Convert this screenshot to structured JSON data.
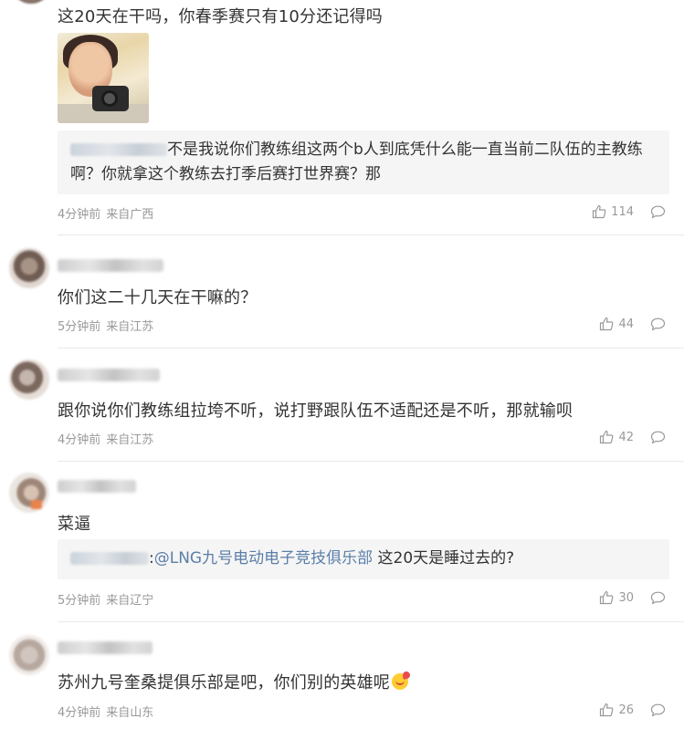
{
  "comments": [
    {
      "text": "这20天在干吗，你春季赛只有10分还记得吗",
      "reply_quote": "不是我说你们教练组这两个b人到底凭什么能一直当前二队伍的主教练",
      "reply_quote_line2": "啊？你就拿这个教练去打季后赛打世界赛？那",
      "time": "4分钟前",
      "location": "来自广西",
      "likes": "114"
    },
    {
      "text": "你们这二十几天在干嘛的？",
      "time": "5分钟前",
      "location": "来自江苏",
      "likes": "44"
    },
    {
      "text": "跟你说你们教练组拉垮不听，说打野跟队伍不适配还是不听，那就输呗",
      "time": "4分钟前",
      "location": "来自江苏",
      "likes": "42"
    },
    {
      "text": "菜逼",
      "reply_prefix": ":",
      "reply_mention": "@LNG九号电动电子竞技俱乐部",
      "reply_text": " 这20天是睡过去的?",
      "time": "5分钟前",
      "location": "来自辽宁",
      "likes": "30"
    },
    {
      "text": "苏州九号奎桑提俱乐部是吧，你们别的英雄呢",
      "time": "4分钟前",
      "location": "来自山东",
      "likes": "26"
    }
  ],
  "icons": {
    "like": "thumbs-up-icon",
    "reply": "comment-bubble-icon",
    "emoji": "heart-kiss-emoji-icon"
  },
  "colors": {
    "text": "#333333",
    "meta": "#999999",
    "mention": "#5b7ea8",
    "quote_bg": "#f5f5f5"
  }
}
